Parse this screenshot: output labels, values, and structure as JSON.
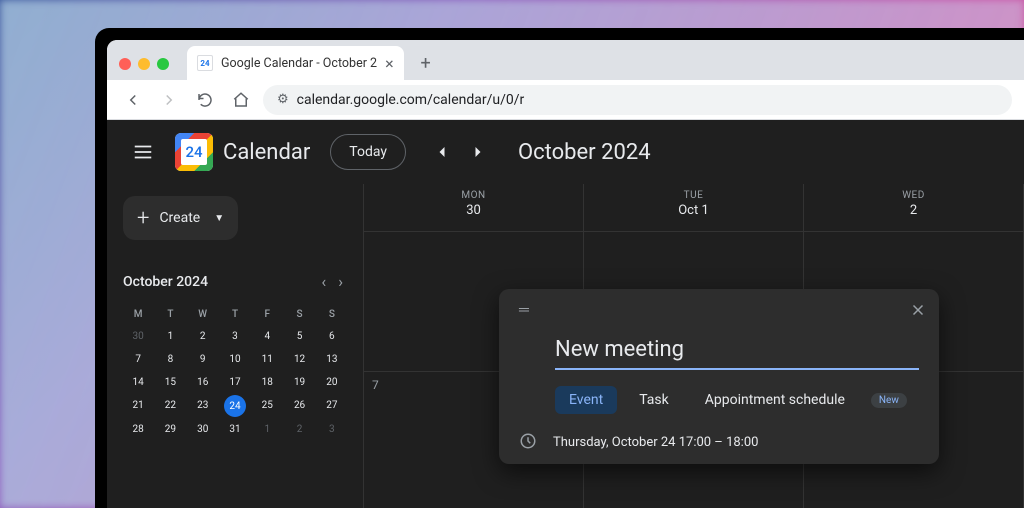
{
  "browser": {
    "tab_title": "Google Calendar - October 2",
    "url": "calendar.google.com/calendar/u/0/r",
    "favicon_text": "24"
  },
  "header": {
    "app_name": "Calendar",
    "logo_day": "24",
    "today_btn": "Today",
    "month_title": "October 2024"
  },
  "sidebar": {
    "create_label": "Create",
    "mini_title": "October 2024",
    "dow": [
      "M",
      "T",
      "W",
      "T",
      "F",
      "S",
      "S"
    ],
    "weeks": [
      [
        {
          "n": "30",
          "dim": true
        },
        {
          "n": "1"
        },
        {
          "n": "2"
        },
        {
          "n": "3"
        },
        {
          "n": "4"
        },
        {
          "n": "5"
        },
        {
          "n": "6"
        }
      ],
      [
        {
          "n": "7"
        },
        {
          "n": "8"
        },
        {
          "n": "9"
        },
        {
          "n": "10"
        },
        {
          "n": "11"
        },
        {
          "n": "12"
        },
        {
          "n": "13"
        }
      ],
      [
        {
          "n": "14"
        },
        {
          "n": "15"
        },
        {
          "n": "16"
        },
        {
          "n": "17"
        },
        {
          "n": "18"
        },
        {
          "n": "19"
        },
        {
          "n": "20"
        }
      ],
      [
        {
          "n": "21"
        },
        {
          "n": "22"
        },
        {
          "n": "23"
        },
        {
          "n": "24",
          "today": true
        },
        {
          "n": "25"
        },
        {
          "n": "26"
        },
        {
          "n": "27"
        }
      ],
      [
        {
          "n": "28"
        },
        {
          "n": "29"
        },
        {
          "n": "30"
        },
        {
          "n": "31"
        },
        {
          "n": "1",
          "dim": true
        },
        {
          "n": "2",
          "dim": true
        },
        {
          "n": "3",
          "dim": true
        }
      ]
    ]
  },
  "main": {
    "days": [
      {
        "dow": "MON",
        "num": "30"
      },
      {
        "dow": "TUE",
        "num": "Oct 1"
      },
      {
        "dow": "WED",
        "num": "2"
      }
    ],
    "row2_first": "7"
  },
  "popup": {
    "title_value": "New meeting",
    "tabs": {
      "event": "Event",
      "task": "Task",
      "appt": "Appointment schedule",
      "new_badge": "New"
    },
    "time_text": "Thursday, October 24   17:00  –  18:00"
  }
}
